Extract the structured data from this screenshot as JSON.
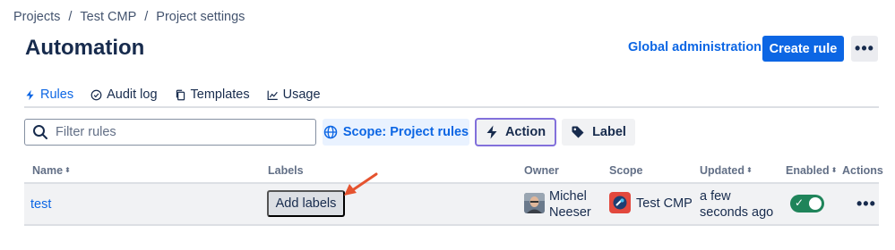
{
  "breadcrumb": {
    "items": [
      "Projects",
      "Test CMP",
      "Project settings"
    ],
    "separator": "/"
  },
  "header": {
    "title": "Automation",
    "global_admin_label": "Global administration",
    "create_rule_label": "Create rule",
    "more_label": "•••"
  },
  "tabs": [
    {
      "label": "Rules",
      "icon": "lightning-icon",
      "active": true
    },
    {
      "label": "Audit log",
      "icon": "check-circle-icon",
      "active": false
    },
    {
      "label": "Templates",
      "icon": "copy-icon",
      "active": false
    },
    {
      "label": "Usage",
      "icon": "chart-line-icon",
      "active": false
    }
  ],
  "filters": {
    "search_placeholder": "Filter rules",
    "scope_label": "Scope: Project rules",
    "action_label": "Action",
    "label_label": "Label"
  },
  "table": {
    "columns": [
      "Name",
      "Labels",
      "Owner",
      "Scope",
      "Updated",
      "Enabled",
      "Actions"
    ],
    "rows": [
      {
        "name": "test",
        "labels_button": "Add labels",
        "owner": "Michel Neeser",
        "scope": "Test CMP",
        "updated": "a few seconds ago",
        "enabled": true,
        "actions": "•••"
      }
    ]
  },
  "colors": {
    "accent": "#0c66e4",
    "toggle_on": "#1f845a",
    "annotation_arrow": "#e5532f",
    "project_icon": "#e2483d"
  }
}
